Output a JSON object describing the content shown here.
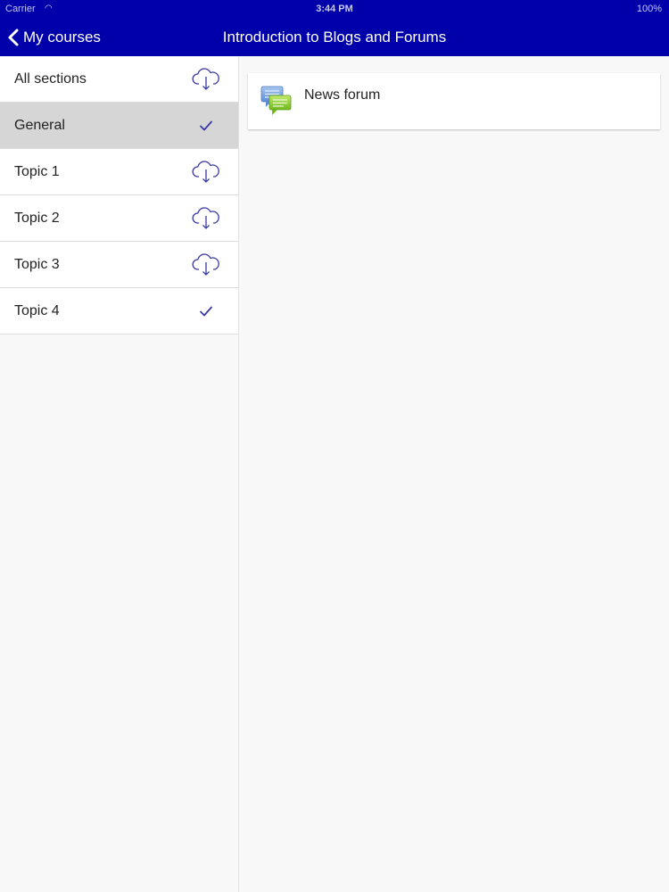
{
  "status_bar": {
    "carrier": "Carrier",
    "time": "3:44 PM",
    "battery": "100%"
  },
  "nav": {
    "back_label": "My courses",
    "title": "Introduction to Blogs and Forums"
  },
  "sections": [
    {
      "label": "All sections",
      "icon": "cloud-download-icon",
      "selected": false
    },
    {
      "label": "General",
      "icon": "checkmark-icon",
      "selected": true
    },
    {
      "label": "Topic 1",
      "icon": "cloud-download-icon",
      "selected": false
    },
    {
      "label": "Topic 2",
      "icon": "cloud-download-icon",
      "selected": false
    },
    {
      "label": "Topic 3",
      "icon": "cloud-download-icon",
      "selected": false
    },
    {
      "label": "Topic 4",
      "icon": "checkmark-icon",
      "selected": false
    }
  ],
  "modules": [
    {
      "label": "News forum",
      "icon": "forum-icon"
    }
  ],
  "colors": {
    "nav_background": "#0000aa",
    "accent": "#3a3aa8",
    "selected_row": "#d6d6d6"
  }
}
